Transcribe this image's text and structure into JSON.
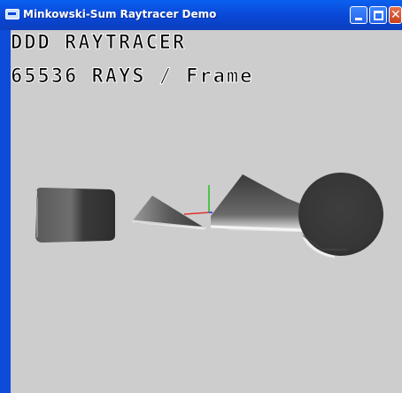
{
  "window": {
    "title": "Minkowski-Sum Raytracer Demo",
    "icons": {
      "app": "window-app-icon",
      "minimize": "minimize-icon",
      "maximize": "maximize-icon",
      "close": "close-icon"
    },
    "close_glyph": "✕"
  },
  "hud": {
    "line1": "DDD RAYTRACER",
    "line2": "65536 RAYS / Frame"
  },
  "colors": {
    "titlebar": "#0a46d6",
    "background": "#cdcdcd",
    "shape": "#3a3a3a",
    "axis_x": "#e03030",
    "axis_y": "#20c020"
  }
}
